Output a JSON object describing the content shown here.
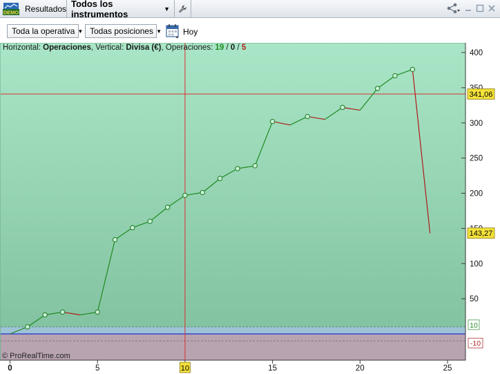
{
  "titlebar": {
    "logo_text": "DEMO",
    "tab_resultados": "Resultados",
    "tab_instrumentos": "Todos los instrumentos"
  },
  "toolbar": {
    "operativa": "Toda la operativa",
    "posiciones": "Todas posiciones",
    "hoy": "Hoy"
  },
  "header": {
    "horizontal_label": "Horizontal: ",
    "horizontal_value": "Operaciones",
    "vertical_label": ", Vertical: ",
    "vertical_value": "Divisa (€)",
    "ops_label": ", Operaciones: ",
    "ops_total": "19",
    "ops_sep1": " / ",
    "ops_mid": "0",
    "ops_sep2": " / ",
    "ops_loss": "5"
  },
  "copyright": "© ProRealTime.com",
  "colors": {
    "win_line": "#1e8a1e",
    "loss_line": "#b01818",
    "crosshair": "#d83030",
    "label_yellow": "#f4e23a",
    "zero_line": "#2233cc"
  },
  "chart_data": {
    "type": "line",
    "x": [
      0,
      1,
      2,
      3,
      4,
      5,
      6,
      7,
      8,
      9,
      10,
      11,
      12,
      13,
      14,
      15,
      16,
      17,
      18,
      19,
      20,
      21,
      22,
      23,
      24
    ],
    "y": [
      0,
      10,
      27,
      31,
      27,
      31,
      134,
      151,
      160,
      180,
      197,
      201,
      221,
      235,
      239,
      302,
      297,
      309,
      305,
      322,
      318,
      349,
      367,
      376,
      143
    ],
    "markers": [
      false,
      true,
      true,
      true,
      false,
      true,
      true,
      true,
      true,
      true,
      true,
      true,
      true,
      true,
      true,
      true,
      false,
      true,
      false,
      true,
      false,
      true,
      true,
      true,
      false
    ],
    "xlim": [
      0,
      26.5
    ],
    "ylim": [
      -30,
      415
    ],
    "x_ticks": [
      "0",
      "5",
      "10",
      "15",
      "20",
      "25"
    ],
    "y_ticks": [
      "50",
      "100",
      "150",
      "200",
      "250",
      "300",
      "350",
      "400"
    ],
    "band_upper": "10",
    "band_lower": "-10",
    "crosshair_x": "10",
    "crosshair_y_label": "341,06",
    "last_value_label": "143,27",
    "crosshair_y": 341.06,
    "last_value": 143.27
  }
}
